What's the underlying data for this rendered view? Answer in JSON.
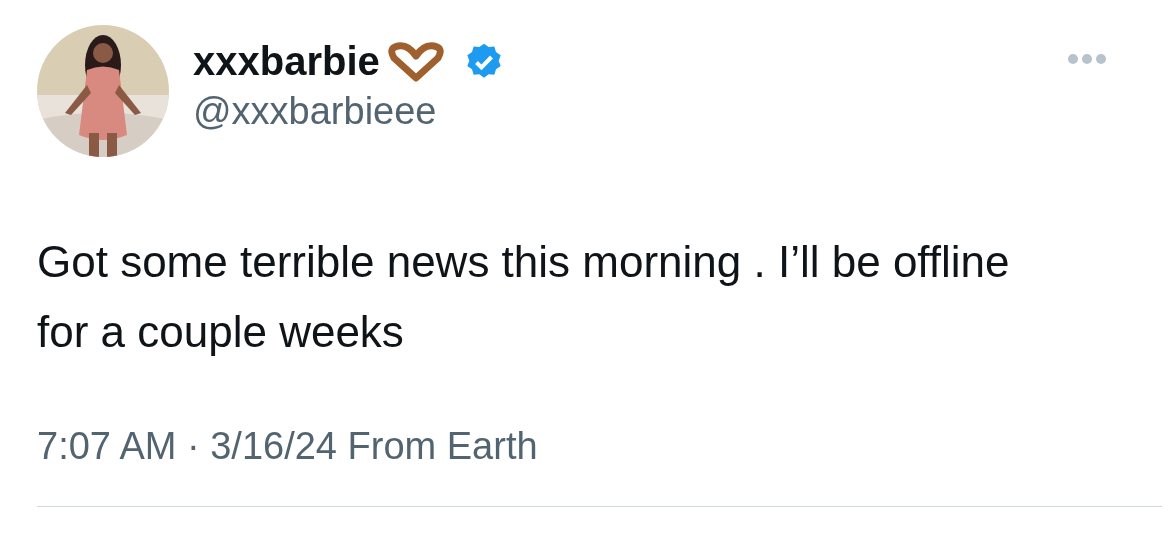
{
  "author": {
    "name": "xxxbarbie",
    "handle": "@xxxbarbieee",
    "verified": true
  },
  "post": {
    "text": "Got some terrible news this morning . I’ll be offline for a couple weeks",
    "timestamp": "7:07 AM · 3/16/24 From Earth"
  }
}
